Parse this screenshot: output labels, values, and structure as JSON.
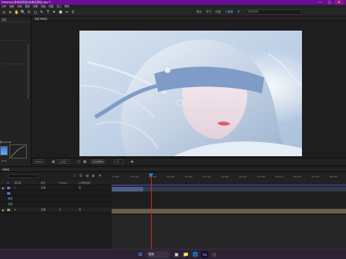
{
  "window": {
    "title": "Desktop\\未命名项目\\未命名项目.aep *",
    "min": "—",
    "max": "▢",
    "close": "✕"
  },
  "menu": [
    "文件",
    "编辑",
    "合成",
    "图层",
    "效果",
    "动画",
    "视图",
    "窗口",
    "帮助"
  ],
  "toolbar": {
    "tools": [
      "⌂",
      "➤",
      "✋",
      "🔍",
      "↻",
      "◻",
      "✎",
      "T",
      "✒",
      "⬟",
      "✂",
      "⚲"
    ],
    "workspaces": [
      "默认",
      "学习",
      "标准",
      "小屏幕",
      "库"
    ],
    "active_workspace": "默认",
    "search_placeholder": "搜索帮助"
  },
  "left_panel": {
    "tab": "项目",
    "effect_label": "色 Curves",
    "tiny1": "RGB",
    "tiny2": "0"
  },
  "composition": {
    "tab": "合成 未命名",
    "view_bar": {
      "zoom": "(50%)",
      "quality": "二分之一",
      "camera": "活动摄像机",
      "views": "1个..."
    }
  },
  "timeline": {
    "tab": "未命名",
    "columns": {
      "num": "#",
      "source": "源名称",
      "mode": "模式",
      "trkmat": "TrkMat",
      "parent": "父级和链接"
    },
    "layers": [
      {
        "name": "1",
        "mode": "正常",
        "trk": "",
        "parent": "无",
        "color": "#4f7ec9",
        "name_color": "#8fb8ff"
      },
      {
        "name": "",
        "mode": "",
        "trk": "",
        "parent": "",
        "color": "#4f7ec9",
        "name_color": "#8fb8ff"
      },
      {
        "name": "重置",
        "mode": "",
        "trk": "",
        "parent": "",
        "color": "#4f7ec9",
        "name_color": "#8fb8ff"
      },
      {
        "name": "位置",
        "mode": "",
        "trk": "",
        "parent": "",
        "color": "#4f7ec9",
        "name_color": "#8fb8ff"
      },
      {
        "name": "2",
        "mode": "正常",
        "trk": "无",
        "parent": "无",
        "color": "#b48c5a",
        "name_color": "#cccccc"
      }
    ],
    "ruler": [
      "0:00f",
      "00:12f",
      "01:00f",
      "01:12f",
      "02:00f",
      "02:12f",
      "03:00f",
      "03:12f",
      "04:00f",
      "04:12f",
      "05:00f",
      "05:12f",
      "06:00f"
    ]
  },
  "taskbar": {
    "start": "⊞",
    "search": "搜索",
    "icons": [
      "▣",
      "📁",
      "🌐",
      "Ae",
      "◎"
    ]
  },
  "colors": {
    "title": "#6a0f95",
    "accent": "#3a7af0",
    "playhead": "#c02a2a"
  }
}
